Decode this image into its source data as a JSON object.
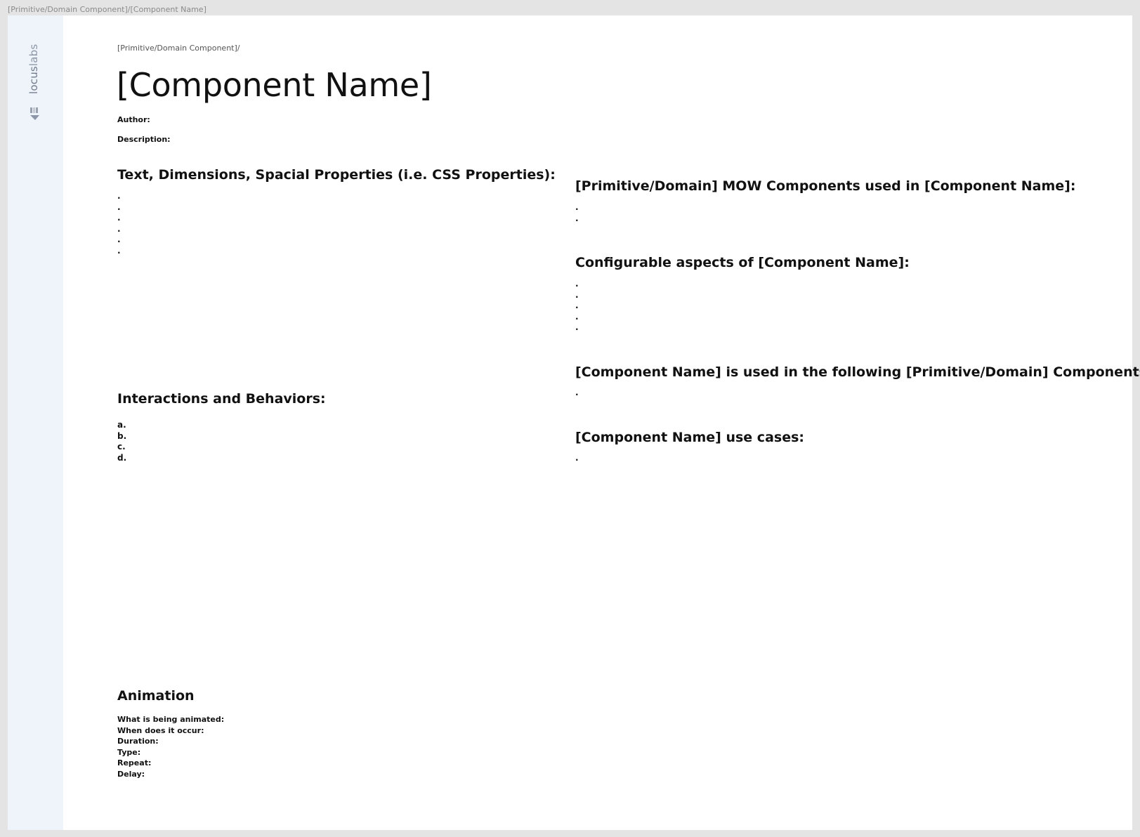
{
  "frame_label": "[Primitive/Domain Component]/[Component Name]",
  "logo": {
    "text_bold": "locus",
    "text_light": "labs"
  },
  "breadcrumb": "[Primitive/Domain Component]/",
  "title": "[Component Name]",
  "author_label": "Author:",
  "description_label": "Description:",
  "left": {
    "properties": {
      "heading": "Text, Dimensions, Spacial Properties (i.e. CSS Properties):",
      "items": [
        ".",
        ".",
        ".",
        ".",
        ".",
        "."
      ]
    },
    "interactions": {
      "heading": "Interactions and Behaviors:",
      "items": [
        "a.",
        "b.",
        "c.",
        "d."
      ]
    },
    "animation": {
      "heading": "Animation",
      "items": [
        "What is being animated:",
        "When does it occur:",
        "Duration:",
        "Type:",
        "Repeat:",
        "Delay:"
      ]
    }
  },
  "right": {
    "mow_components": {
      "heading": "[Primitive/Domain] MOW Components used in [Component Name]:",
      "items": [
        ".",
        "."
      ]
    },
    "configurable": {
      "heading": "Configurable aspects of [Component Name]:",
      "items": [
        ".",
        ".",
        ".",
        ".",
        "."
      ]
    },
    "used_in": {
      "heading": "[Component Name] is used in the following [Primitive/Domain] Components:",
      "items": [
        "."
      ]
    },
    "use_cases": {
      "heading": "[Component Name] use cases:",
      "items": [
        "."
      ]
    }
  }
}
